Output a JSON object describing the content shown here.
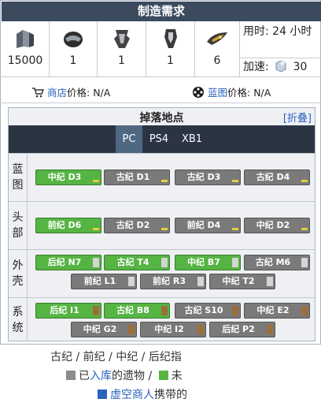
{
  "header": {
    "title": "制造需求"
  },
  "resources": [
    {
      "icon": "alloy-plate-icon",
      "amount": "15000"
    },
    {
      "icon": "helmet-component-icon",
      "amount": "1"
    },
    {
      "icon": "blueprint-component-icon",
      "amount": "1"
    },
    {
      "icon": "shell-component-icon",
      "amount": "1"
    },
    {
      "icon": "orokin-cell-icon",
      "amount": "6"
    }
  ],
  "time": {
    "label": "用时: 24 小时",
    "rush_label": "加速:",
    "rush_cost": "30"
  },
  "prices": {
    "market_label": "商店",
    "market_suffix": "价格: N/A",
    "blueprint_label": "蓝图",
    "blueprint_suffix": "价格: N/A"
  },
  "drops": {
    "title": "掉落地点",
    "collapse_label": "[折叠]",
    "tabs": [
      "PC",
      "PS4",
      "XB1"
    ],
    "active_tab": "PC",
    "sections": [
      {
        "label": "蓝图",
        "rows": [
          [
            {
              "name": "中纪 D3",
              "color": "green",
              "mark": "bar"
            },
            {
              "name": "古纪 D1",
              "color": "gray",
              "mark": "bar"
            },
            {
              "name": "古纪 D3",
              "color": "gray",
              "mark": "bar"
            },
            {
              "name": "古纪 D4",
              "color": "gray",
              "mark": "bar"
            }
          ]
        ]
      },
      {
        "label": "头部",
        "rows": [
          [
            {
              "name": "前纪 D6",
              "color": "green",
              "mark": "bar"
            },
            {
              "name": "古纪 D2",
              "color": "gray",
              "mark": "bar"
            },
            {
              "name": "前纪 D4",
              "color": "gray",
              "mark": "bar"
            },
            {
              "name": "中纪 D2",
              "color": "gray",
              "mark": "bar"
            }
          ]
        ]
      },
      {
        "label": "外壳",
        "rows": [
          [
            {
              "name": "后纪 N7",
              "color": "green",
              "mark": "light"
            },
            {
              "name": "古纪 T4",
              "color": "green",
              "mark": "light"
            },
            {
              "name": "中纪 B7",
              "color": "green",
              "mark": "light"
            },
            {
              "name": "古纪 M6",
              "color": "gray",
              "mark": "light"
            }
          ],
          [
            {
              "name": "前纪 L1",
              "color": "gray",
              "mark": "light"
            },
            {
              "name": "前纪 R3",
              "color": "gray",
              "mark": "light"
            },
            {
              "name": "中纪 T2",
              "color": "gray",
              "mark": "light"
            }
          ]
        ]
      },
      {
        "label": "系统",
        "rows": [
          [
            {
              "name": "后纪 I1",
              "color": "green",
              "mark": "brown"
            },
            {
              "name": "古纪 B8",
              "color": "green",
              "mark": "brown"
            },
            {
              "name": "古纪 S10",
              "color": "gray",
              "mark": "brown"
            },
            {
              "name": "中纪 E2",
              "color": "gray",
              "mark": "brown"
            }
          ],
          [
            {
              "name": "中纪 G2",
              "color": "gray",
              "mark": "brown"
            },
            {
              "name": "中纪 I2",
              "color": "gray",
              "mark": "brown"
            },
            {
              "name": "后纪 P2",
              "color": "gray",
              "mark": "brown"
            }
          ]
        ]
      }
    ]
  },
  "legend": {
    "line1": "古纪 / 前纪 / 中纪 / 后纪指",
    "line2_a": "已",
    "line2_link": "入库",
    "line2_b": "的遗物 /",
    "line2_c": "未",
    "line3_link": "虚空商人",
    "line3_b": "携带的"
  },
  "colors": {
    "header_bg": "#3c4a5e",
    "tabbar_bg": "#2b3443",
    "green": "#56b443",
    "gray": "#7a7a7a",
    "link": "#2a63c0"
  }
}
